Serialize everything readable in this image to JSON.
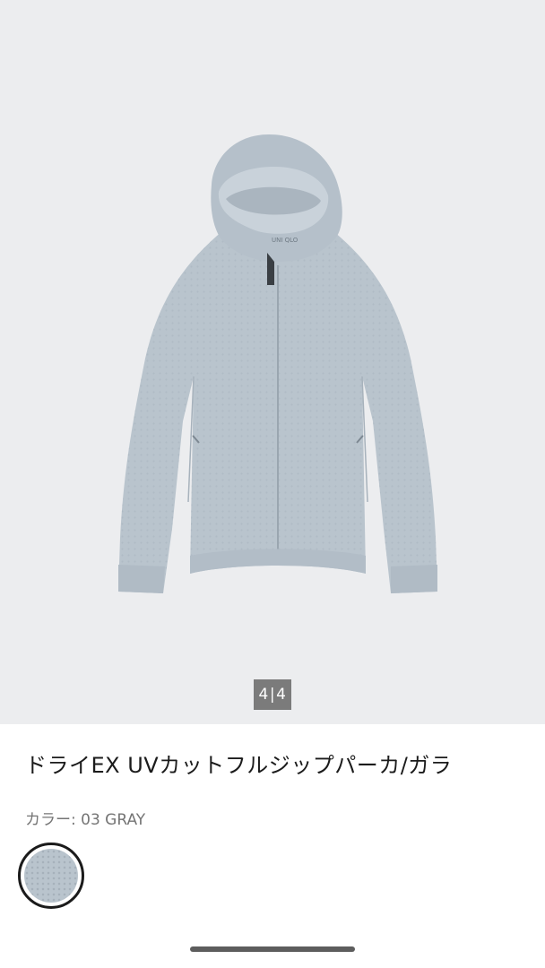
{
  "gallery": {
    "current": "4",
    "separator": "|",
    "total": "4"
  },
  "product": {
    "title": "ドライEX UVカットフルジップパーカ/ガラ",
    "color_label": "カラー: 03 GRAY",
    "swatch_color": "#b9c4cd"
  },
  "image": {
    "brand_tag": "UNI QLO"
  },
  "colors": {
    "background": "#ffffff",
    "gallery_bg": "#ecedef",
    "garment": "#b9c4cd",
    "counter_bg": "#7b7b7b"
  }
}
